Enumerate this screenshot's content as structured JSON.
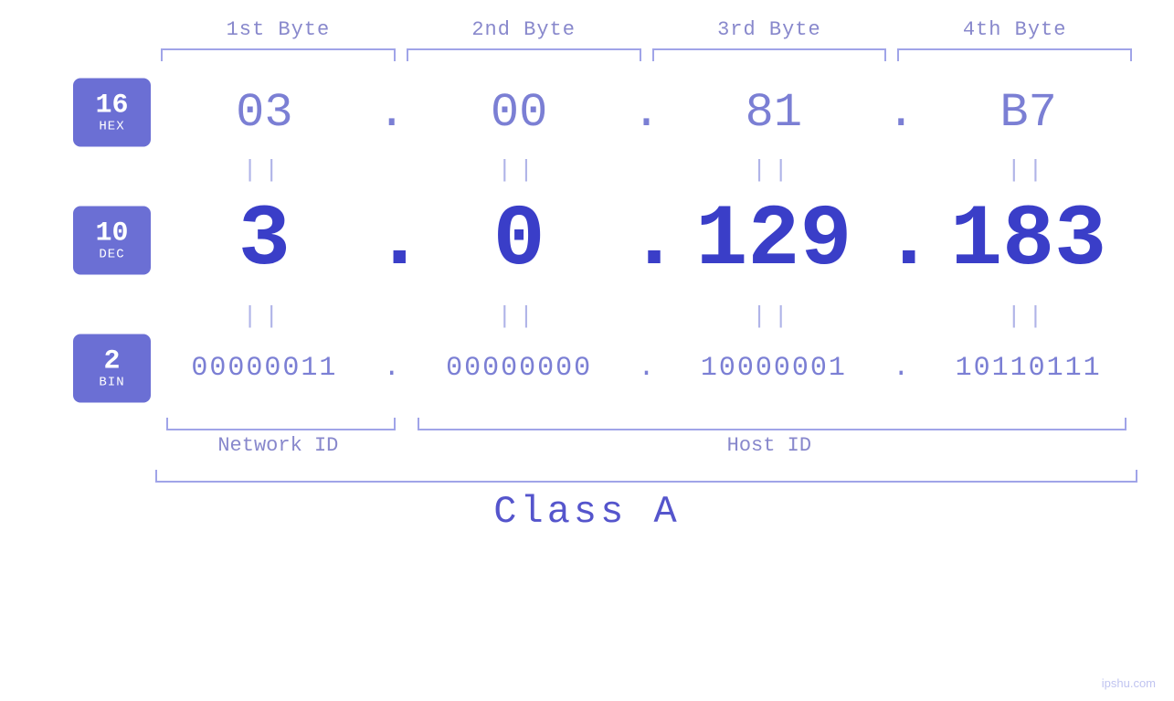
{
  "headers": {
    "byte1": "1st Byte",
    "byte2": "2nd Byte",
    "byte3": "3rd Byte",
    "byte4": "4th Byte"
  },
  "badges": {
    "hex": {
      "num": "16",
      "base": "HEX"
    },
    "dec": {
      "num": "10",
      "base": "DEC"
    },
    "bin": {
      "num": "2",
      "base": "BIN"
    }
  },
  "hex_values": [
    "03",
    "00",
    "81",
    "B7"
  ],
  "dec_values": [
    "3",
    "0",
    "129",
    "183"
  ],
  "bin_values": [
    "00000011",
    "00000000",
    "10000001",
    "10110111"
  ],
  "dot": ".",
  "equals": "||",
  "labels": {
    "network_id": "Network ID",
    "host_id": "Host ID",
    "class": "Class A"
  },
  "watermark": "ipshu.com"
}
